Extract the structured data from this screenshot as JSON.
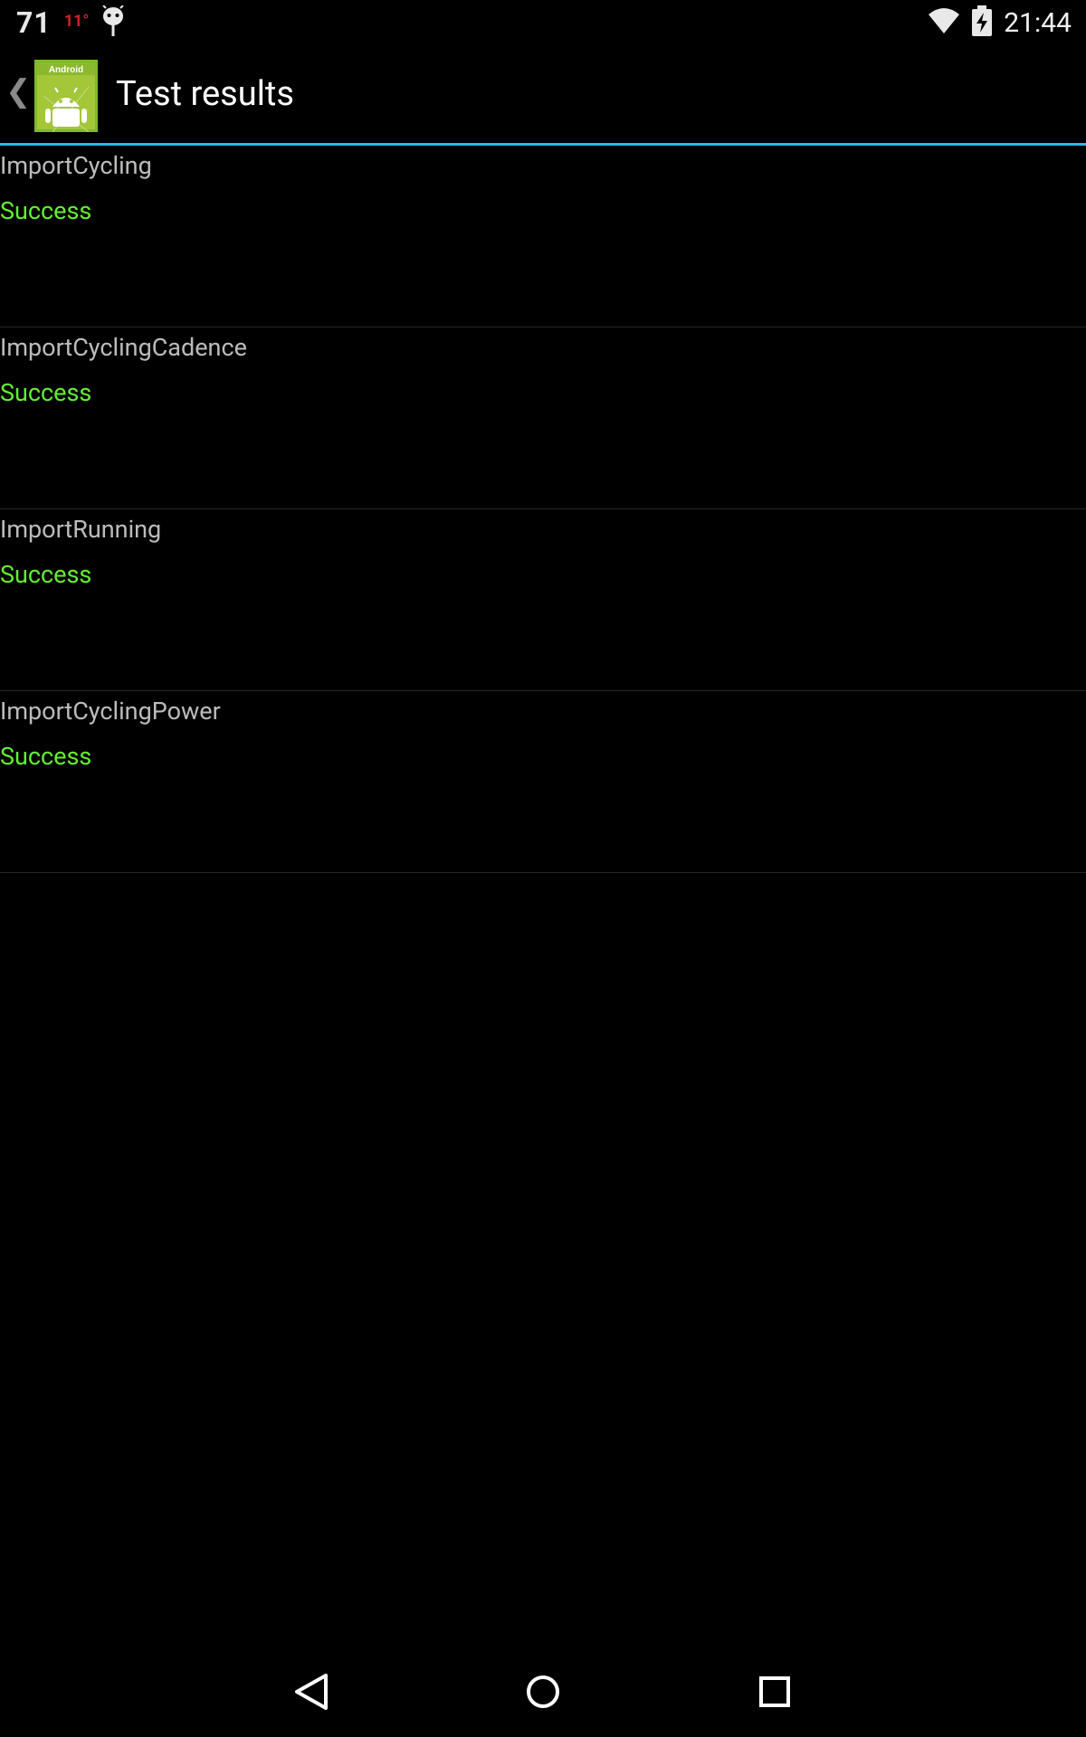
{
  "status_bar": {
    "notification_number": "71",
    "temperature": "11°",
    "time": "21:44",
    "icons": [
      "android-debug-icon",
      "wifi-icon",
      "battery-charging-icon"
    ]
  },
  "action_bar": {
    "title": "Test results",
    "icon_label": "Android",
    "accent_color": "#33b5e5"
  },
  "results": [
    {
      "name": "ImportCycling",
      "status": "Success"
    },
    {
      "name": "ImportCyclingCadence",
      "status": "Success"
    },
    {
      "name": "ImportRunning",
      "status": "Success"
    },
    {
      "name": "ImportCyclingPower",
      "status": "Success"
    }
  ],
  "colors": {
    "success": "#66ee33",
    "background": "#000000"
  },
  "nav_bar": {
    "buttons": [
      "back-icon",
      "home-icon",
      "recents-icon"
    ]
  }
}
